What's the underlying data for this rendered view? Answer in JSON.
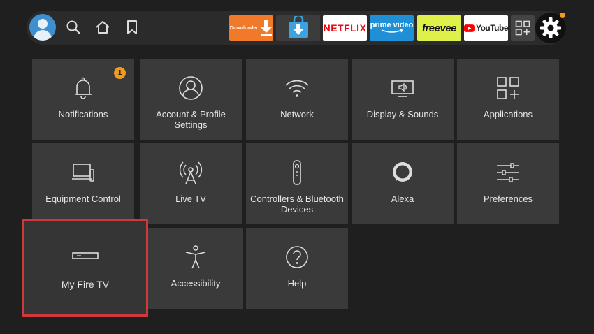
{
  "topbar": {
    "apps": [
      {
        "id": "downloader",
        "label": "Downloader",
        "bg": "#f0792a",
        "fg": "#ffffff"
      },
      {
        "id": "app-store-download",
        "label": "",
        "bg": "#3c3c3c",
        "fg": "#4fb3e8"
      },
      {
        "id": "netflix",
        "label": "NETFLIX",
        "bg": "#ffffff",
        "fg": "#e50914"
      },
      {
        "id": "prime-video",
        "label": "prime video",
        "bg": "#1f8fd6",
        "fg": "#ffffff"
      },
      {
        "id": "freevee",
        "label": "freevee",
        "bg": "#dff04a",
        "fg": "#111111"
      },
      {
        "id": "youtube",
        "label": "YouTube",
        "bg": "#ffffff",
        "fg": "#222222"
      }
    ],
    "icons": {
      "search": "search-icon",
      "home": "home-icon",
      "watchlist": "bookmark-icon",
      "all_apps": "app-grid-icon",
      "settings": "gear-icon"
    }
  },
  "settings_tiles": [
    {
      "label": "Notifications",
      "icon": "bell-icon",
      "badge": "1"
    },
    {
      "label": "Account & Profile Settings",
      "icon": "account-icon"
    },
    {
      "label": "Network",
      "icon": "wifi-icon"
    },
    {
      "label": "Display & Sounds",
      "icon": "display-speaker-icon"
    },
    {
      "label": "Applications",
      "icon": "applications-grid-icon"
    },
    {
      "label": "Equipment Control",
      "icon": "tv-remote-icon"
    },
    {
      "label": "Live TV",
      "icon": "antenna-icon"
    },
    {
      "label": "Controllers & Bluetooth Devices",
      "icon": "remote-icon"
    },
    {
      "label": "Alexa",
      "icon": "alexa-icon"
    },
    {
      "label": "Preferences",
      "icon": "sliders-icon"
    },
    {
      "label": "My Fire TV",
      "icon": "fire-tv-device-icon",
      "focused": true
    },
    {
      "label": "Accessibility",
      "icon": "accessibility-icon"
    },
    {
      "label": "Help",
      "icon": "help-icon"
    }
  ],
  "colors": {
    "focus": "#d0393c",
    "badge": "#f39a1e",
    "tile": "#3a3a3a",
    "background": "#1f1f1f"
  }
}
